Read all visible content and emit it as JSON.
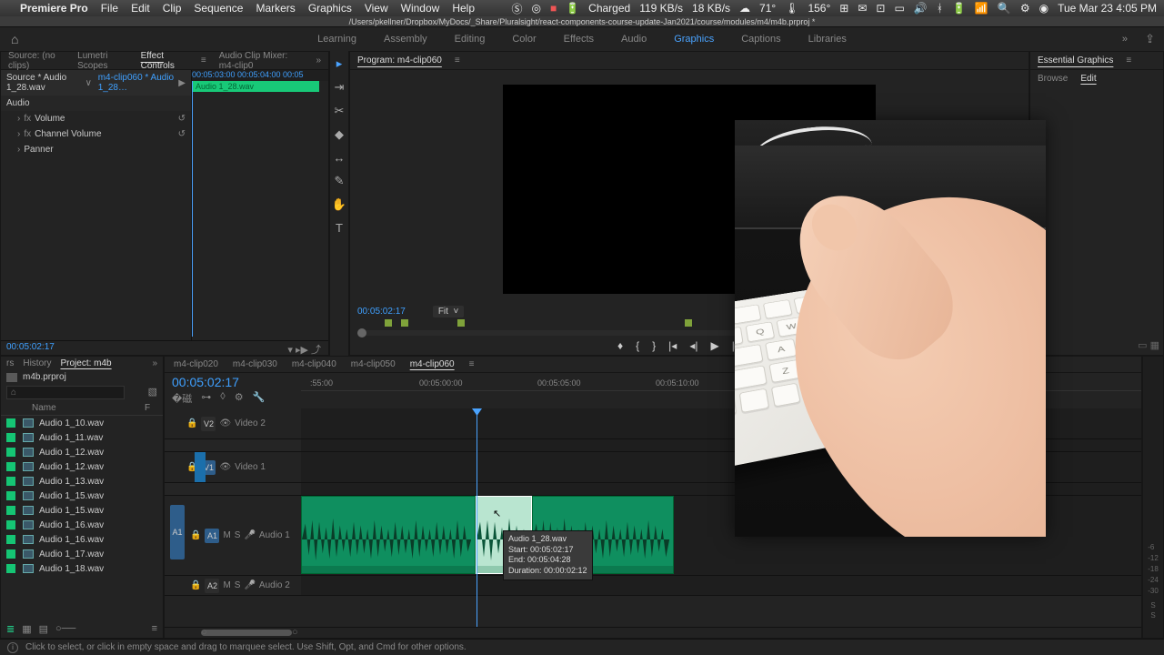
{
  "macbar": {
    "app": "Premiere Pro",
    "menus": [
      "File",
      "Edit",
      "Clip",
      "Sequence",
      "Markers",
      "Graphics",
      "View",
      "Window",
      "Help"
    ],
    "battery": "Charged",
    "net1": "119 KB/s",
    "net2": "18 KB/s",
    "temp_out": "71°",
    "temp_cpu": "156°",
    "clock": "Tue Mar 23  4:05 PM"
  },
  "project_path": "/Users/pkellner/Dropbox/MyDocs/_Share/Pluralsight/react-components-course-update-Jan2021/course/modules/m4/m4b.prproj *",
  "workspaces": {
    "items": [
      "Learning",
      "Assembly",
      "Editing",
      "Color",
      "Effects",
      "Audio",
      "Graphics",
      "Captions",
      "Libraries"
    ],
    "active": "Graphics"
  },
  "source_panel": {
    "tabs": [
      "Source: (no clips)",
      "Lumetri Scopes",
      "Effect Controls",
      "Audio Clip Mixer: m4-clip0"
    ],
    "active": "Effect Controls"
  },
  "effect_controls": {
    "source_label": "Source * Audio 1_28.wav",
    "seq_label": "m4-clip060 * Audio 1_28…",
    "tc_marks": [
      "00:05:03:00",
      "00:05:04:00",
      "00:05"
    ],
    "clip_name": "Audio 1_28.wav",
    "group": "Audio",
    "fx": [
      "Volume",
      "Channel Volume",
      "Panner"
    ]
  },
  "program": {
    "title": "Program: m4-clip060",
    "timecode": "00:05:02:17",
    "fit": "Fit"
  },
  "essential_graphics": {
    "title": "Essential Graphics",
    "tabs": [
      "Browse",
      "Edit"
    ],
    "active": "Edit"
  },
  "project": {
    "playhead_tc": "00:05:02:17",
    "tabs": [
      "rs",
      "History",
      "Project: m4b"
    ],
    "active": "Project: m4b",
    "bin": "m4b.prproj",
    "col_name": "Name",
    "col_f": "F",
    "items": [
      "Audio 1_10.wav",
      "Audio 1_11.wav",
      "Audio 1_12.wav",
      "Audio 1_12.wav",
      "Audio 1_13.wav",
      "Audio 1_15.wav",
      "Audio 1_15.wav",
      "Audio 1_16.wav",
      "Audio 1_16.wav",
      "Audio 1_17.wav",
      "Audio 1_18.wav"
    ]
  },
  "timeline": {
    "tabs": [
      "m4-clip020",
      "m4-clip030",
      "m4-clip040",
      "m4-clip050",
      "m4-clip060"
    ],
    "active": "m4-clip060",
    "timecode": "00:05:02:17",
    "ruler": [
      ":55:00",
      "00:05:00:00",
      "00:05:05:00",
      "00:05:10:00"
    ],
    "tracks": {
      "v2": "Video 2",
      "v1": "Video 1",
      "a1": "Audio 1",
      "a2": "Audio 2",
      "badge_v1": "V1",
      "badge_v2": "V2",
      "badge_a1": "A1",
      "badge_a2": "A2",
      "src_a1": "A1"
    },
    "tooltip": {
      "name": "Audio 1_28.wav",
      "start": "Start: 00:05:02:17",
      "end": "End: 00:05:04:28",
      "dur": "Duration: 00:00:02:12"
    },
    "meters_label": "S"
  },
  "status": "Click to select, or click in empty space and drag to marquee select. Use Shift, Opt, and Cmd for other options.",
  "icons": {
    "ripple": "⎆",
    "home": "⌂"
  }
}
